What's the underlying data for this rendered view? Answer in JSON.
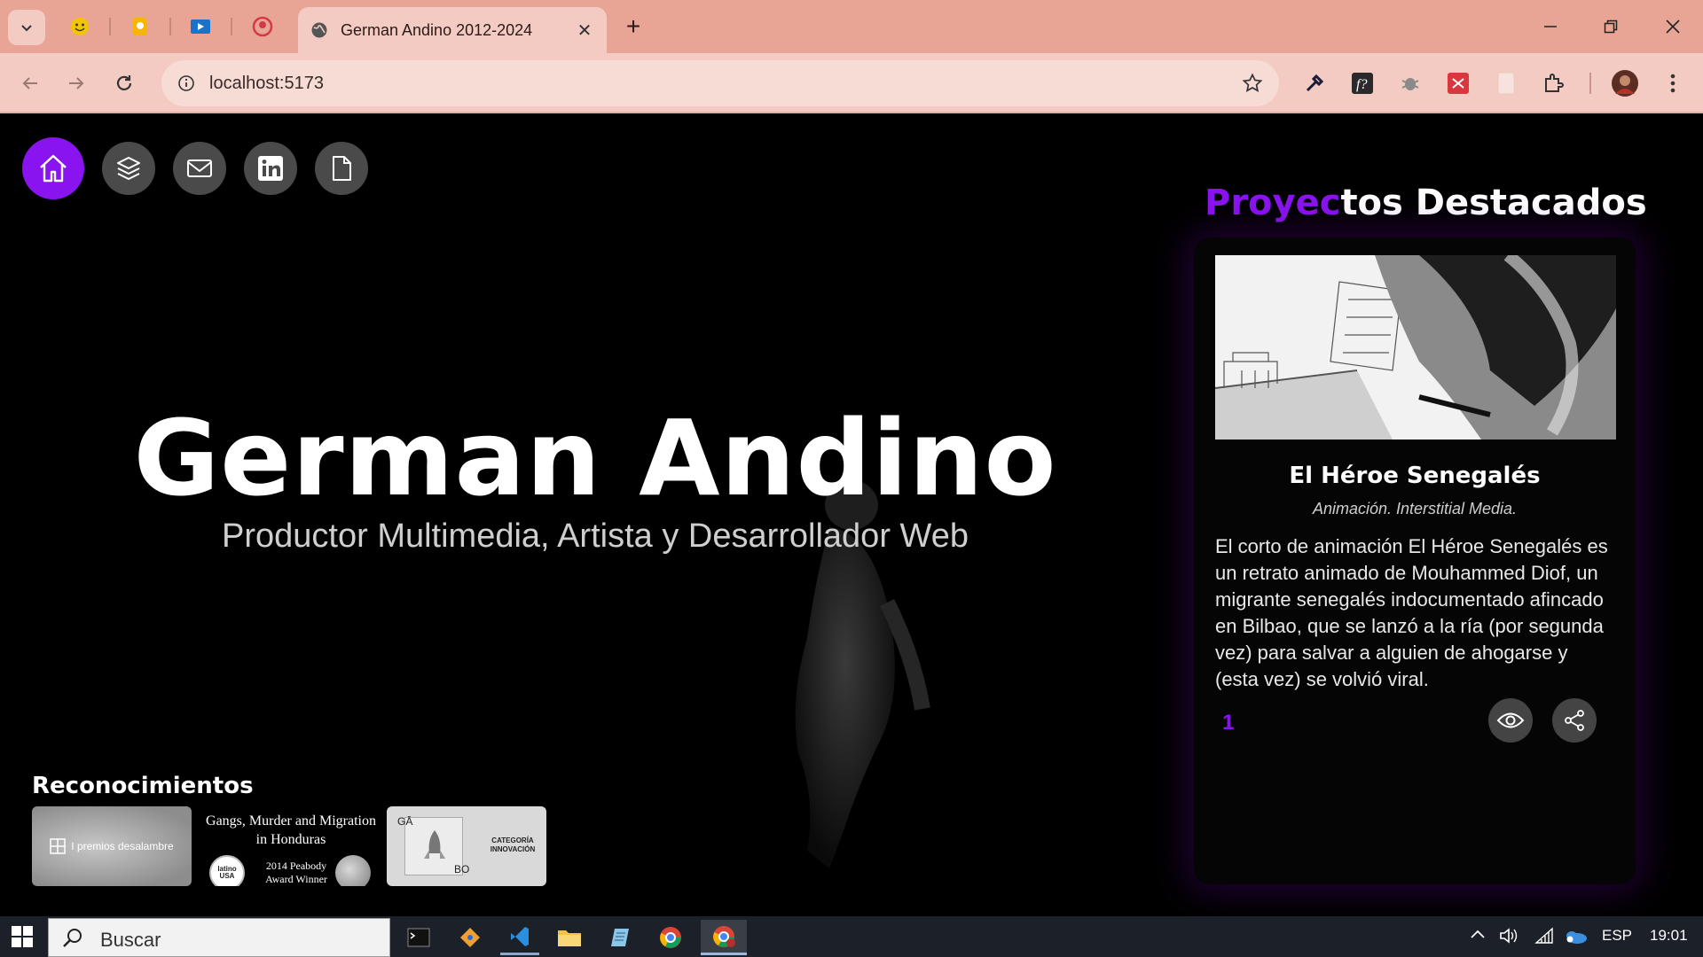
{
  "browser": {
    "active_tab_title": "German Andino 2012-2024",
    "url": "localhost:5173",
    "tab_close": "✕",
    "new_tab": "+"
  },
  "nav": {
    "items": [
      "home-icon",
      "layers-icon",
      "mail-icon",
      "linkedin-icon",
      "document-icon"
    ]
  },
  "hero": {
    "name": "German Andino",
    "subtitle": "Productor Multimedia, Artista y Desarrollador Web"
  },
  "recognitions": {
    "title": "Reconocimientos",
    "award1_label": "I premios desalambre",
    "award2_title": "Gangs, Murder and Migration in Honduras",
    "award2_seal": "latino USA",
    "award2_caption": "2014 Peabody Award Winner",
    "award3_top": "GĀ",
    "award3_bottom": "BO",
    "award3_category": "CATEGORÍA INNOVACIÓN"
  },
  "featured": {
    "title_accent": "Proyec",
    "title_rest": "tos Destacados",
    "project": {
      "title": "El Héroe Senegalés",
      "subtitle": "Animación. Interstitial Media.",
      "description": "El corto de animación El Héroe Senegalés es un retrato animado de Mouhammed Diof, un migrante senegalés indocumentado afincado en Bilbao, que se lanzó a la ría (por segunda vez) para salvar a alguien de ahogarse y (esta vez) se volvió viral.",
      "index": "1"
    }
  },
  "taskbar": {
    "search_placeholder": "Buscar",
    "language": "ESP",
    "time": "19:01"
  },
  "colors": {
    "accent": "#8a14f0",
    "chrome": "#e8a596",
    "toolbar": "#f4cbc2"
  }
}
